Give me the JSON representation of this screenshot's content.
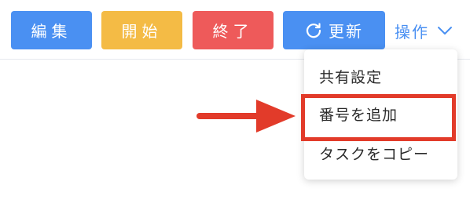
{
  "toolbar": {
    "edit_label": "編集",
    "start_label": "開始",
    "end_label": "終了",
    "update_label": "更新",
    "operations_label": "操作"
  },
  "menu": {
    "items": [
      {
        "label": "共有設定"
      },
      {
        "label": "番号を追加"
      },
      {
        "label": "タスクをコピー"
      }
    ]
  },
  "colors": {
    "primary": "#4a90f2",
    "warning": "#f4bb45",
    "danger": "#ee5a5a",
    "annotation": "#e23b2a"
  },
  "icons": {
    "update": "refresh-icon",
    "operations": "chevron-down-icon",
    "annotation": "arrow-right-icon"
  }
}
